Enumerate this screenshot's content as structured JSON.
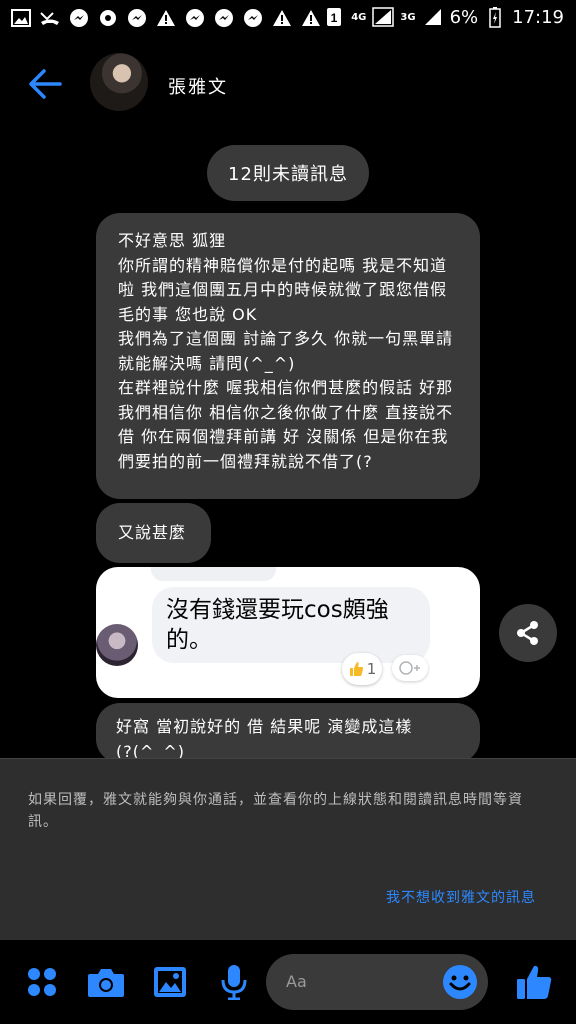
{
  "status_bar": {
    "network_1": "4G",
    "network_2": "3G",
    "sim_slot": "1",
    "battery": "6%",
    "time": "17:19"
  },
  "header": {
    "contact_name": "張雅文"
  },
  "unread_pill": "12則未讀訊息",
  "messages": {
    "m1": "不好意思 狐狸\n你所謂的精神賠償你是付的起嗎 我是不知道啦 我們這個團五月中的時候就徵了跟您借假毛的事 您也說 OK\n我們為了這個團 討論了多久 你就一句黑單請 就能解決嗎 請問(^_^)\n在群裡說什麼 喔我相信你們甚麼的假話 好那我們相信你 相信你之後你做了什麼 直接說不借 你在兩個禮拜前講 好 沒關係 但是你在我們要拍的前一個禮拜就說不借了(?",
    "m2": "又說甚麼",
    "m4": "好窩 當初說好的 借 結果呢 演變成這樣\n(?(^_^)"
  },
  "screenshot": {
    "comment_text": "沒有錢還要玩cos頗強\n的。",
    "like_count": "1"
  },
  "notice": {
    "text": "如果回覆，雅文就能夠與你通話，並查看你的上線狀態和閱讀訊息時間等資訊。",
    "link": "我不想收到雅文的訊息"
  },
  "composer": {
    "placeholder": "Aa"
  },
  "colors": {
    "accent": "#2d88ff",
    "bubble": "#3a3a3a",
    "background": "#000000"
  }
}
